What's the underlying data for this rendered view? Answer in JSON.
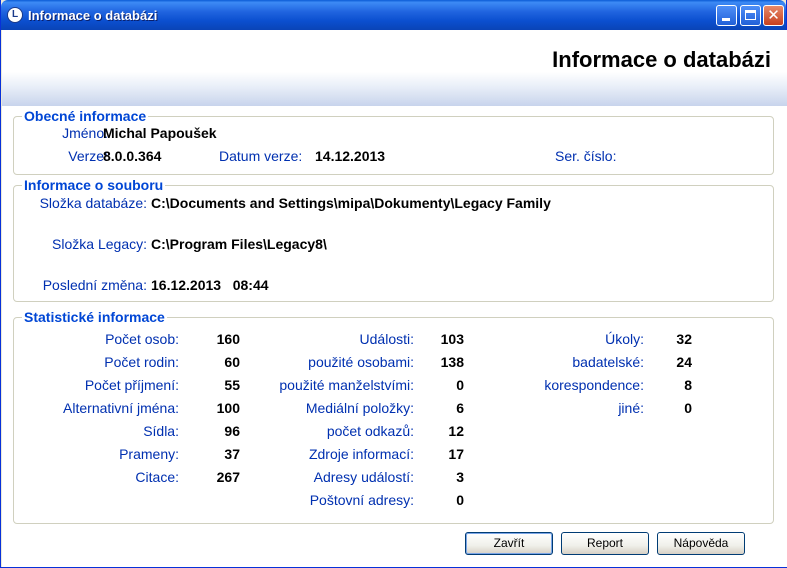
{
  "window": {
    "title": "Informace o databázi",
    "app_icon_letter": "L"
  },
  "header": {
    "title": "Informace o databázi"
  },
  "general": {
    "legend": "Obecné informace",
    "name_label": "Jméno:",
    "name": "Michal Papoušek",
    "version_label": "Verze:",
    "version": "8.0.0.364",
    "version_date_label": "Datum verze:",
    "version_date": "14.12.2013",
    "serial_label": "Ser. číslo:",
    "serial": ""
  },
  "file": {
    "legend": "Informace o souboru",
    "db_folder_label": "Složka databáze:",
    "db_folder": "C:\\Documents and Settings\\mipa\\Dokumenty\\Legacy Family",
    "legacy_folder_label": "Složka Legacy:",
    "legacy_folder": "C:\\Program Files\\Legacy8\\",
    "last_change_label": "Poslední změna:",
    "last_change": "16.12.2013   08:44"
  },
  "stats": {
    "legend": "Statistické informace",
    "col1": [
      {
        "label": "Počet osob:",
        "value": "160"
      },
      {
        "label": "Počet rodin:",
        "value": "60"
      },
      {
        "label": "Počet příjmení:",
        "value": "55"
      },
      {
        "label": "Alternativní jména:",
        "value": "100"
      },
      {
        "label": "Sídla:",
        "value": "96"
      },
      {
        "label": "Prameny:",
        "value": "37"
      },
      {
        "label": "Citace:",
        "value": "267"
      }
    ],
    "col2": [
      {
        "label": "Události:",
        "value": "103"
      },
      {
        "label": "použité osobami:",
        "value": "138"
      },
      {
        "label": "použité manželstvími:",
        "value": "0"
      },
      {
        "label": "Mediální položky:",
        "value": "6"
      },
      {
        "label": "počet odkazů:",
        "value": "12"
      },
      {
        "label": "Zdroje informací:",
        "value": "17"
      },
      {
        "label": "Adresy událostí:",
        "value": "3"
      },
      {
        "label": "Poštovní adresy:",
        "value": "0"
      }
    ],
    "col3": [
      {
        "label": "Úkoly:",
        "value": "32"
      },
      {
        "label": "badatelské:",
        "value": "24"
      },
      {
        "label": "korespondence:",
        "value": "8"
      },
      {
        "label": "jiné:",
        "value": "0"
      }
    ]
  },
  "buttons": {
    "close": "Zavřít",
    "report": "Report",
    "help": "Nápověda"
  },
  "colors": {
    "label": "#0030b0",
    "legend": "#0046d5",
    "titlebar": "#0a4fcf"
  }
}
